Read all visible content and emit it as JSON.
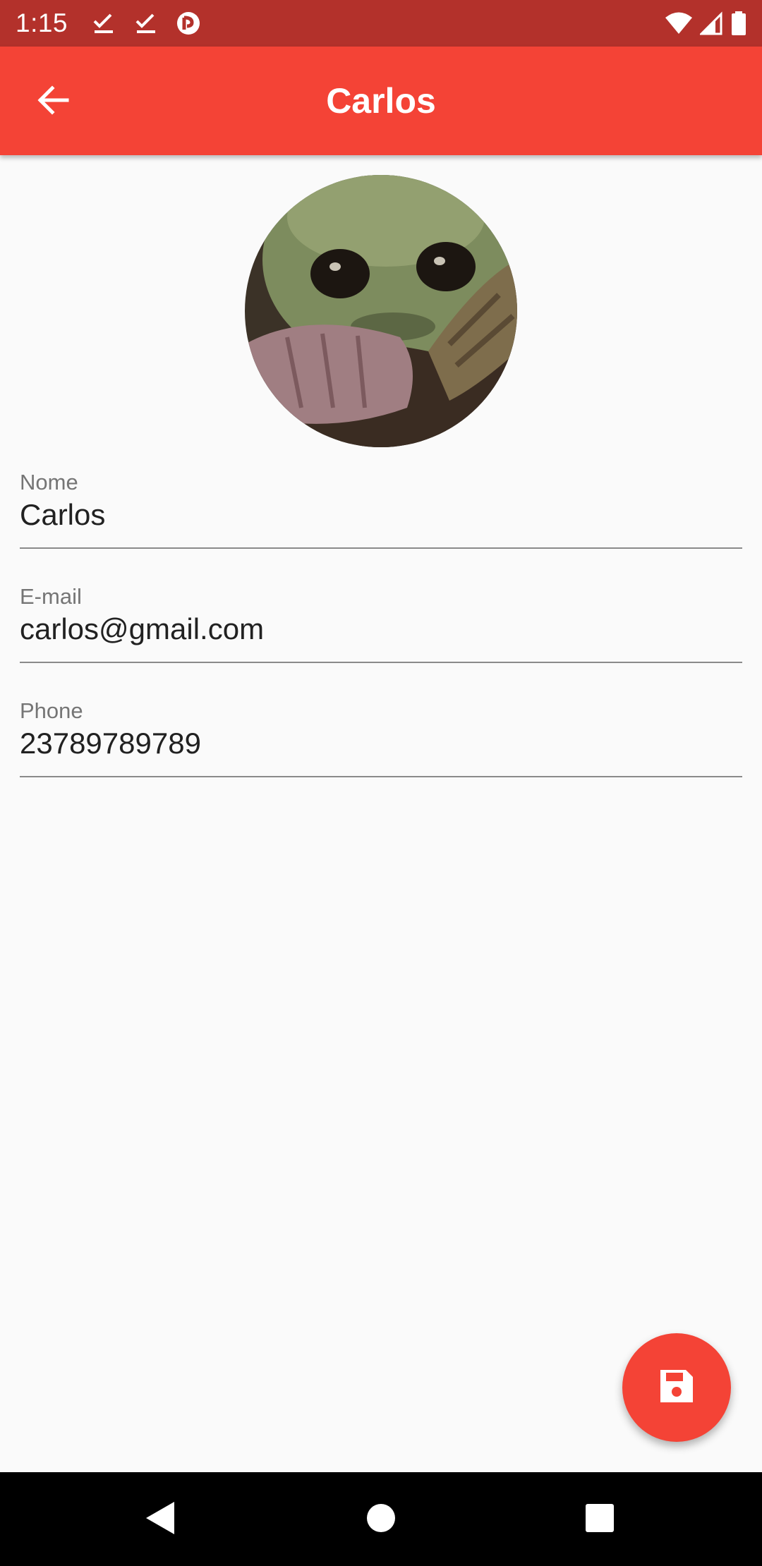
{
  "status_bar": {
    "time": "1:15",
    "left_icons": [
      "download-done-icon",
      "download-done-icon",
      "app-notification-icon"
    ],
    "right_icons": [
      "wifi-icon",
      "cell-signal-icon",
      "battery-icon"
    ]
  },
  "app_bar": {
    "title": "Carlos",
    "back_icon": "arrow-back-icon",
    "color": "#f44336"
  },
  "avatar": {
    "alt": "contact photo"
  },
  "form": {
    "name": {
      "label": "Nome",
      "value": "Carlos"
    },
    "email": {
      "label": "E-mail",
      "value": "carlos@gmail.com"
    },
    "phone": {
      "label": "Phone",
      "value": "23789789789"
    }
  },
  "fab": {
    "icon": "save-icon",
    "color": "#f44336"
  },
  "nav_bar": {
    "buttons": [
      "back-triangle-icon",
      "home-circle-icon",
      "recents-square-icon"
    ]
  }
}
